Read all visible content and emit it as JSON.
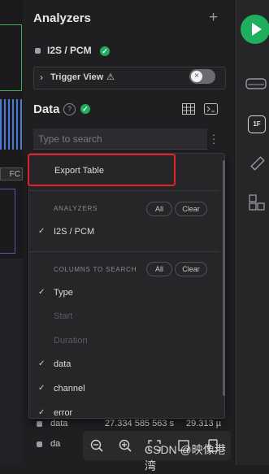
{
  "waveform": {
    "tag_label": "FC"
  },
  "panel": {
    "title": "Analyzers",
    "add_symbol": "+",
    "analyzer": {
      "name": "I2S / PCM"
    },
    "trigger": {
      "label": "Trigger View",
      "warn": "⚠"
    },
    "data_section": {
      "title": "Data",
      "help": "?"
    },
    "search": {
      "placeholder": "Type to search"
    }
  },
  "menu": {
    "export_label": "Export Table",
    "analyzers_heading": "ANALYZERS",
    "all_label": "All",
    "clear_label": "Clear",
    "analyzer_items": [
      {
        "label": "I2S / PCM",
        "checked": true
      }
    ],
    "columns_heading": "COLUMNS TO SEARCH",
    "column_items": [
      {
        "label": "Type",
        "checked": true
      },
      {
        "label": "Start",
        "checked": false
      },
      {
        "label": "Duration",
        "checked": false
      },
      {
        "label": "data",
        "checked": true
      },
      {
        "label": "channel",
        "checked": true
      },
      {
        "label": "error",
        "checked": true
      }
    ]
  },
  "table_rows": [
    {
      "type": "data",
      "start": "27.334 585 563 s",
      "dur": "29.313 µ"
    },
    {
      "type": "da"
    }
  ],
  "watermark": "CSDN @映像港湾",
  "rail": {
    "badge": "1F"
  },
  "colors": {
    "accent": "#1fae5b",
    "highlight": "#e02424"
  }
}
